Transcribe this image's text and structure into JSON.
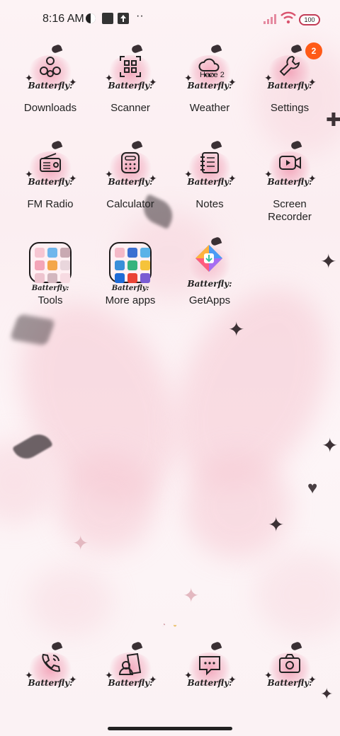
{
  "status_bar": {
    "time": "8:16 AM",
    "battery": "100",
    "icons": [
      "vpn-icon",
      "square-icon",
      "upload-icon",
      "more-dots-icon",
      "signal-icon",
      "wifi-icon",
      "battery-icon"
    ]
  },
  "theme": {
    "brand_text": "Batterfly:",
    "accent": "#f3a9bd",
    "ink": "#222222",
    "badge_color": "#ff5a17"
  },
  "apps": [
    {
      "label": "Downloads",
      "icon": "download-nodes-icon"
    },
    {
      "label": "Scanner",
      "icon": "qr-scanner-icon"
    },
    {
      "label": "Weather",
      "icon": "cloud-weather-icon",
      "overlay": "Haze 2"
    },
    {
      "label": "Settings",
      "icon": "wrench-icon",
      "badge": "2"
    },
    {
      "label": "FM Radio",
      "icon": "radio-icon"
    },
    {
      "label": "Calculator",
      "icon": "calculator-icon"
    },
    {
      "label": "Notes",
      "icon": "notebook-icon"
    },
    {
      "label": "Screen Recorder",
      "icon": "video-recorder-icon"
    },
    {
      "label": "Tools",
      "icon": "folder-icon"
    },
    {
      "label": "More apps",
      "icon": "folder-icon"
    },
    {
      "label": "GetApps",
      "icon": "getapps-icon"
    }
  ],
  "dock": [
    {
      "icon": "phone-icon"
    },
    {
      "icon": "contacts-icon"
    },
    {
      "icon": "messages-icon"
    },
    {
      "icon": "camera-icon"
    }
  ]
}
